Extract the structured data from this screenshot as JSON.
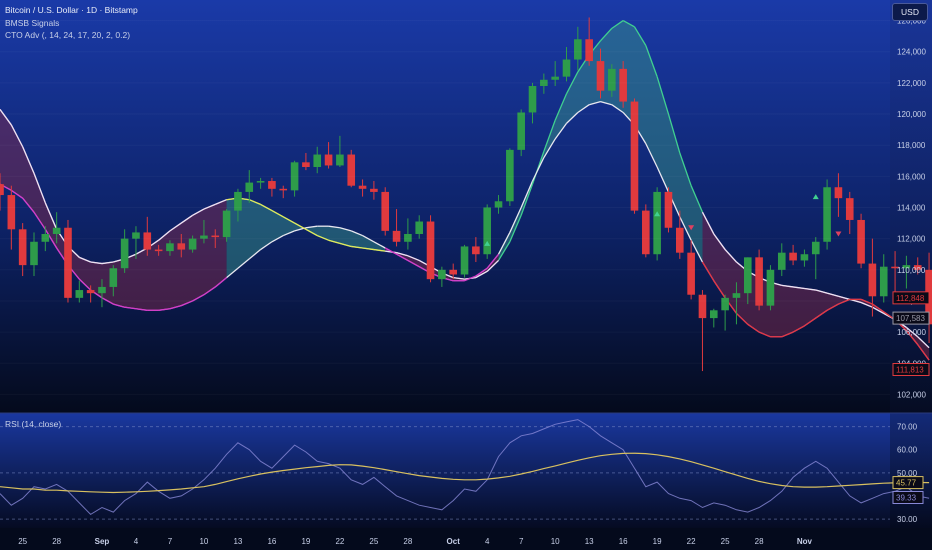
{
  "header": {
    "title": "Bitcoin / U.S. Dollar · 1D · Bitstamp",
    "indicator1": "BMSB Signals",
    "indicator2": "CTO Adv (, 14, 24, 17, 20, 2, 0.2)",
    "currency_button": "USD"
  },
  "rsi_panel": {
    "label": "RSI (14, close)"
  },
  "colors": {
    "bull": "#2e9c4a",
    "bear": "#e03a3e",
    "band_bull_fill": "#3a9a8a",
    "band_bear_fill": "#8a2a4a",
    "line_white": "#e8e8f0",
    "line_yellow": "#e6e65a",
    "line_magenta": "#d040c8",
    "line_green": "#40d090",
    "rsi_line": "#8a8ad8",
    "rsi_ma": "#d8c060"
  },
  "chart_data": [
    {
      "type": "candlestick",
      "title": "Bitcoin / U.S. Dollar · 1D · Bitstamp",
      "ylim": [
        101000,
        127000
      ],
      "y_ticks": [
        102000,
        104000,
        106000,
        108000,
        110000,
        112000,
        114000,
        116000,
        118000,
        120000,
        122000,
        124000,
        126000
      ],
      "y_tick_labels": [
        "102,000",
        "104,000",
        "106,000",
        "108,000",
        "110,000",
        "112,000",
        "114,000",
        "116,000",
        "118,000",
        "120,000",
        "122,000",
        "124,000",
        "126,000"
      ],
      "x_tick_labels": [
        "25",
        "28",
        "Sep",
        "4",
        "7",
        "10",
        "13",
        "16",
        "19",
        "22",
        "25",
        "28",
        "Oct",
        "4",
        "7",
        "10",
        "13",
        "16",
        "19",
        "22",
        "25",
        "28",
        "Nov"
      ],
      "x_tick_index": [
        2,
        5,
        9,
        12,
        15,
        18,
        21,
        24,
        27,
        30,
        33,
        36,
        40,
        43,
        46,
        49,
        52,
        55,
        58,
        61,
        64,
        67,
        71
      ],
      "candles": [
        [
          115500,
          116200,
          113800,
          114800
        ],
        [
          114800,
          115400,
          111300,
          112600
        ],
        [
          112600,
          113000,
          109600,
          110300
        ],
        [
          110300,
          112400,
          109600,
          111800
        ],
        [
          111800,
          112800,
          111200,
          112300
        ],
        [
          112300,
          113700,
          111700,
          112700
        ],
        [
          112700,
          113200,
          107900,
          108200
        ],
        [
          108200,
          109300,
          107900,
          108700
        ],
        [
          108700,
          109000,
          107900,
          108500
        ],
        [
          108500,
          109400,
          107600,
          108900
        ],
        [
          108900,
          110300,
          108300,
          110100
        ],
        [
          110100,
          112600,
          109800,
          112000
        ],
        [
          112000,
          112800,
          110700,
          112400
        ],
        [
          112400,
          113400,
          110900,
          111300
        ],
        [
          111300,
          111600,
          110900,
          111200
        ],
        [
          111200,
          111900,
          110900,
          111700
        ],
        [
          111700,
          112300,
          110800,
          111300
        ],
        [
          111300,
          112200,
          111100,
          112000
        ],
        [
          112000,
          113200,
          111700,
          112200
        ],
        [
          112200,
          112600,
          111400,
          112100
        ],
        [
          112100,
          113900,
          111800,
          113800
        ],
        [
          113800,
          115200,
          113100,
          115000
        ],
        [
          115000,
          116400,
          114300,
          115600
        ],
        [
          115600,
          115900,
          115200,
          115700
        ],
        [
          115700,
          115900,
          114700,
          115200
        ],
        [
          115200,
          115400,
          114600,
          115100
        ],
        [
          115100,
          117000,
          114700,
          116900
        ],
        [
          116900,
          117500,
          116400,
          116600
        ],
        [
          116600,
          117900,
          116200,
          117400
        ],
        [
          117400,
          118200,
          116500,
          116700
        ],
        [
          116700,
          118600,
          116600,
          117400
        ],
        [
          117400,
          117700,
          115300,
          115400
        ],
        [
          115400,
          115800,
          114700,
          115200
        ],
        [
          115200,
          115700,
          114500,
          115000
        ],
        [
          115000,
          115300,
          112200,
          112500
        ],
        [
          112500,
          113900,
          111500,
          111800
        ],
        [
          111800,
          113300,
          111300,
          112300
        ],
        [
          112300,
          113500,
          112000,
          113100
        ],
        [
          113100,
          113500,
          109200,
          109400
        ],
        [
          109400,
          110200,
          108900,
          110000
        ],
        [
          110000,
          110400,
          109400,
          109700
        ],
        [
          109700,
          111600,
          109500,
          111500
        ],
        [
          111500,
          112100,
          110500,
          111000
        ],
        [
          111000,
          114200,
          110700,
          114000
        ],
        [
          114000,
          114800,
          113600,
          114400
        ],
        [
          114400,
          117800,
          114100,
          117700
        ],
        [
          117700,
          120300,
          117300,
          120100
        ],
        [
          120100,
          122000,
          119400,
          121800
        ],
        [
          121800,
          122600,
          121300,
          122200
        ],
        [
          122200,
          123400,
          121800,
          122400
        ],
        [
          122400,
          124300,
          122100,
          123500
        ],
        [
          123500,
          125600,
          122800,
          124800
        ],
        [
          124800,
          126200,
          123100,
          123400
        ],
        [
          123400,
          124200,
          121000,
          121500
        ],
        [
          121500,
          123200,
          121100,
          122900
        ],
        [
          122900,
          123400,
          120400,
          120800
        ],
        [
          120800,
          121000,
          113600,
          113800
        ],
        [
          113800,
          114200,
          110800,
          111000
        ],
        [
          111000,
          115300,
          110600,
          115000
        ],
        [
          115000,
          115300,
          112400,
          112700
        ],
        [
          112700,
          113800,
          110700,
          111100
        ],
        [
          111100,
          111900,
          108100,
          108400
        ],
        [
          108400,
          108700,
          103500,
          106900
        ],
        [
          106900,
          107500,
          106300,
          107400
        ],
        [
          107400,
          108400,
          106100,
          108200
        ],
        [
          108200,
          109200,
          106500,
          108500
        ],
        [
          108500,
          110800,
          107800,
          110800
        ],
        [
          110800,
          111300,
          107400,
          107700
        ],
        [
          107700,
          110300,
          107400,
          110000
        ],
        [
          110000,
          111700,
          109600,
          111100
        ],
        [
          111100,
          111600,
          110300,
          110600
        ],
        [
          110600,
          111300,
          110200,
          111000
        ],
        [
          111000,
          112100,
          109400,
          111800
        ],
        [
          111800,
          115800,
          111300,
          115300
        ],
        [
          115300,
          116200,
          113400,
          114600
        ],
        [
          114600,
          115000,
          112300,
          113200
        ],
        [
          113200,
          113600,
          110100,
          110400
        ],
        [
          110400,
          112000,
          107000,
          108300
        ],
        [
          108300,
          111000,
          107900,
          110200
        ],
        [
          110200,
          111200,
          107800,
          110100
        ],
        [
          110100,
          110900,
          108800,
          110300
        ],
        [
          110300,
          110800,
          109700,
          110000
        ],
        [
          110000,
          111100,
          105300,
          106500
        ]
      ],
      "signals_up": [
        [
          43,
          111700
        ],
        [
          58,
          113600
        ],
        [
          72,
          114700
        ]
      ],
      "signals_down": [
        [
          61,
          112700
        ],
        [
          74,
          112300
        ]
      ],
      "band_upper": [
        120300,
        119300,
        117900,
        116200,
        114300,
        112600,
        111500,
        110800,
        110500,
        110400,
        110500,
        110700,
        111000,
        111400,
        111900,
        112500,
        113000,
        113500,
        113900,
        114200,
        114500,
        114600,
        114500,
        114200,
        113800,
        113400,
        113000,
        112600,
        112200,
        111900,
        111700,
        111500,
        111400,
        111300,
        111200,
        111100,
        110900,
        110600,
        110200,
        109800,
        109500,
        109400,
        109500,
        109900,
        110600,
        111800,
        113500,
        115500,
        117600,
        119600,
        121300,
        122700,
        123800,
        124700,
        125500,
        126000,
        125600,
        124400,
        122400,
        120000,
        117500,
        115400,
        113700,
        112300,
        111300,
        110500,
        109900,
        109500,
        109200,
        109000,
        108900,
        108800,
        108700,
        108500,
        108300,
        108100,
        107900,
        107600,
        107200,
        106800,
        106300,
        105700,
        105000
      ],
      "band_lower": [
        115500,
        115100,
        114600,
        113700,
        112600,
        111400,
        110300,
        109400,
        108700,
        108200,
        107800,
        107600,
        107500,
        107400,
        107400,
        107500,
        107700,
        108000,
        108400,
        108900,
        109500,
        110100,
        110700,
        111300,
        111800,
        112200,
        112500,
        112700,
        112800,
        112800,
        112700,
        112500,
        112200,
        111800,
        111400,
        111000,
        110600,
        110200,
        109800,
        109500,
        109300,
        109300,
        109600,
        110100,
        111000,
        112400,
        114000,
        115700,
        117200,
        118400,
        119400,
        120100,
        120600,
        120800,
        120600,
        120100,
        119300,
        118100,
        116600,
        115000,
        113400,
        111900,
        110500,
        109300,
        108200,
        107200,
        106500,
        106000,
        105700,
        105700,
        106000,
        106400,
        106900,
        107400,
        107800,
        108100,
        108100,
        107800,
        107300,
        106800,
        106100,
        105200,
        104200
      ],
      "band_color": [
        "bear",
        "bear",
        "bear",
        "bear",
        "bear",
        "bear",
        "bear",
        "bear",
        "bear",
        "bear",
        "bear",
        "bear",
        "bear",
        "bear",
        "bear",
        "bear",
        "bear",
        "bear",
        "bear",
        "bear",
        "bull",
        "bull",
        "bull",
        "bull",
        "bull",
        "bull",
        "bull",
        "bull",
        "bull",
        "bull",
        "bull",
        "bull",
        "bull",
        "bull",
        "bear",
        "bear",
        "bear",
        "bear",
        "bear",
        "bear",
        "bear",
        "bear",
        "bear",
        "bear",
        "bull",
        "bull",
        "bull",
        "bull",
        "bull",
        "bull",
        "bull",
        "bull",
        "bull",
        "bull",
        "bull",
        "bull",
        "bull",
        "bull",
        "bull",
        "bull",
        "bull",
        "bull",
        "bear",
        "bear",
        "bear",
        "bear",
        "bear",
        "bear",
        "bear",
        "bear",
        "bear",
        "bear",
        "bear",
        "bear",
        "bear",
        "bear",
        "bear",
        "bear",
        "bear",
        "bear",
        "bear",
        "bear",
        "bear"
      ],
      "price_labels": [
        {
          "text": "112,848",
          "value": 108200,
          "color": "#e03a3e"
        },
        {
          "text": "107,583",
          "value": 106900,
          "color": "#9a9aa8"
        },
        {
          "text": "111,813",
          "value": 103600,
          "color": "#e03a3e"
        }
      ]
    },
    {
      "type": "line",
      "title": "RSI (14, close)",
      "ylim": [
        27,
        75
      ],
      "y_ticks": [
        30,
        40,
        50,
        60,
        70
      ],
      "y_tick_labels": [
        "30.00",
        "",
        "50.00",
        "60.00",
        "70.00"
      ],
      "hlines": [
        30,
        50,
        70
      ],
      "series": [
        {
          "name": "RSI",
          "values": [
            41,
            36,
            39,
            44,
            43,
            45,
            42,
            37,
            32,
            35,
            33,
            38,
            41,
            46,
            42,
            39,
            40,
            43,
            47,
            52,
            58,
            63,
            60,
            55,
            52,
            57,
            62,
            59,
            55,
            54,
            52,
            47,
            45,
            48,
            44,
            40,
            38,
            36,
            35,
            34,
            38,
            43,
            42,
            47,
            57,
            63,
            66,
            67,
            69,
            71,
            72,
            73,
            70,
            66,
            63,
            60,
            52,
            44,
            46,
            41,
            39,
            38,
            35,
            37,
            36,
            34,
            33,
            35,
            38,
            42,
            48,
            52,
            55,
            52,
            46,
            40,
            37,
            39,
            41,
            42,
            44,
            40,
            39
          ]
        },
        {
          "name": "RSI-MA",
          "values": [
            44,
            43.5,
            43,
            43,
            42.5,
            42.5,
            42.2,
            42,
            41.8,
            41.6,
            41.5,
            41.6,
            41.8,
            42,
            42.3,
            42.6,
            43,
            43.5,
            44,
            45,
            46.2,
            47.4,
            48.5,
            49.5,
            50.3,
            51,
            51.6,
            52.2,
            52.7,
            53.2,
            53.5,
            53.4,
            52.9,
            52.2,
            51.4,
            50.5,
            49.6,
            48.8,
            48.2,
            47.6,
            47.2,
            47,
            47,
            47.3,
            47.8,
            48.5,
            49.5,
            50.6,
            51.8,
            53,
            54.2,
            55.4,
            56.5,
            57.4,
            58,
            58.4,
            58.5,
            58.3,
            57.8,
            57,
            56,
            54.8,
            53.4,
            52,
            50.5,
            49,
            47.6,
            46.3,
            45.3,
            44.5,
            44,
            43.8,
            43.8,
            44,
            44.3,
            44.6,
            44.9,
            45.2,
            45.5,
            45.7,
            45.8,
            45.8,
            45.77
          ]
        }
      ],
      "value_labels": [
        {
          "text": "45.77",
          "value": 45.77,
          "color": "#d8c060"
        },
        {
          "text": "39.33",
          "value": 39.33,
          "color": "#8a8ad8"
        }
      ]
    }
  ]
}
